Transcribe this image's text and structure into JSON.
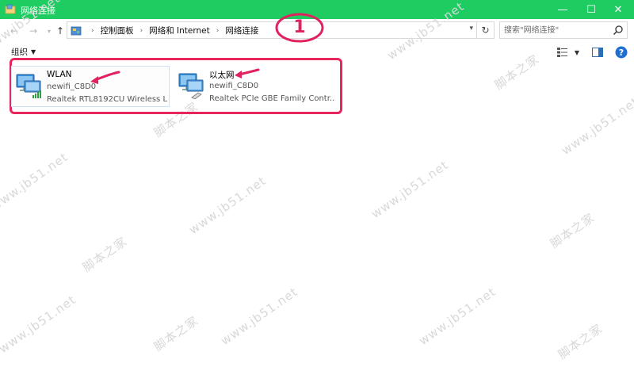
{
  "window": {
    "title": "网络连接"
  },
  "title_buttons": {
    "minimize": "—",
    "maximize": "☐",
    "close": "✕"
  },
  "address": {
    "breadcrumbs": [
      "控制面板",
      "网络和 Internet",
      "网络连接"
    ]
  },
  "search": {
    "placeholder": "搜索\"网络连接\""
  },
  "toolbar": {
    "organize_label": "组织"
  },
  "adapters": [
    {
      "name": "WLAN",
      "network": "newifi_C8D0",
      "device": "Realtek RTL8192CU Wireless L...",
      "icon": "wifi-adapter-icon"
    },
    {
      "name": "以太网",
      "network": "newifi_C8D0",
      "device": "Realtek PCIe GBE Family Contr...",
      "icon": "ethernet-adapter-icon"
    }
  ],
  "annotation": {
    "step_label": "1"
  },
  "watermarks": {
    "site": "www.jb51.net",
    "brand": "脚本之家"
  },
  "colors": {
    "titlebar": "#1fcc62",
    "highlight": "#e8265e",
    "arrow": "#e0235f"
  }
}
